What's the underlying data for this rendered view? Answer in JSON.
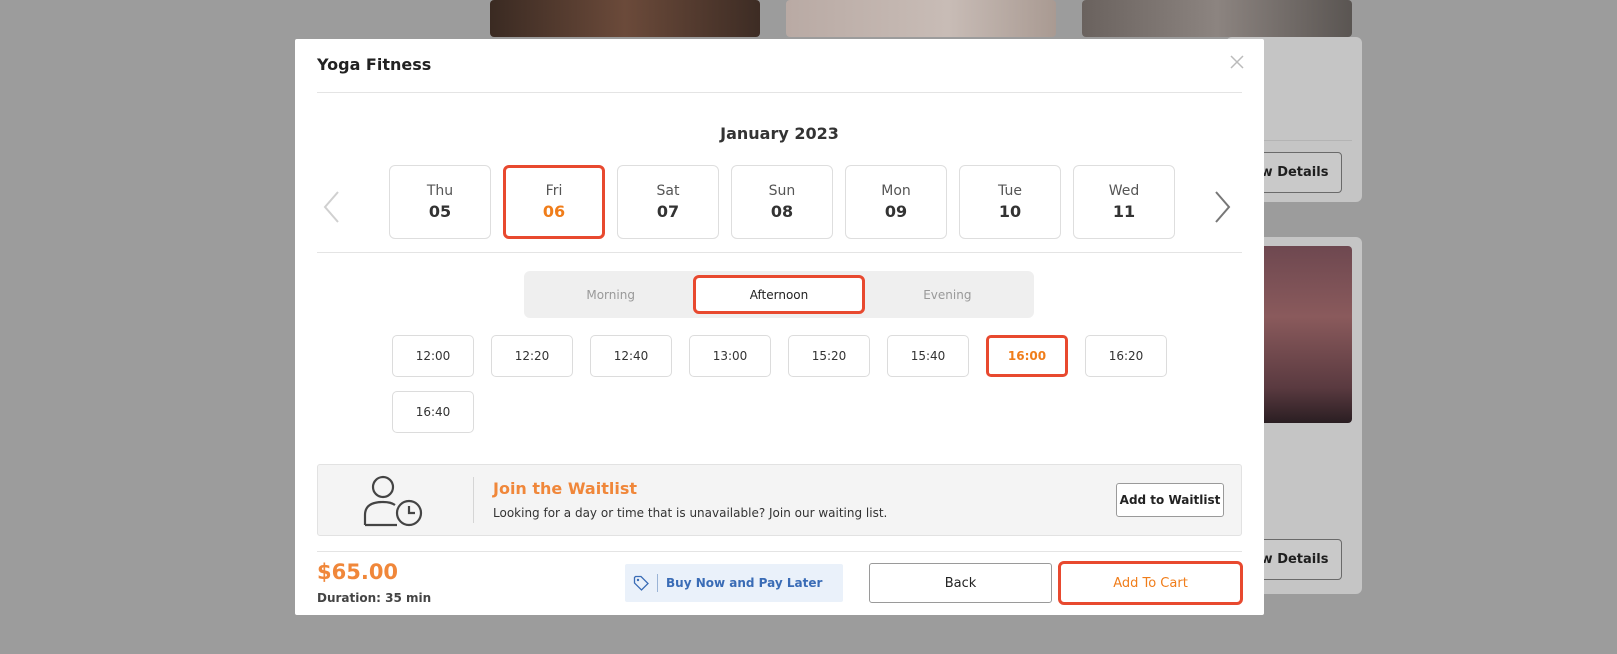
{
  "background": {
    "view_details_label": "View Details"
  },
  "modal": {
    "title": "Yoga Fitness",
    "month": "January 2023",
    "dates": [
      {
        "dow": "Thu",
        "num": "05"
      },
      {
        "dow": "Fri",
        "num": "06"
      },
      {
        "dow": "Sat",
        "num": "07"
      },
      {
        "dow": "Sun",
        "num": "08"
      },
      {
        "dow": "Mon",
        "num": "09"
      },
      {
        "dow": "Tue",
        "num": "10"
      },
      {
        "dow": "Wed",
        "num": "11"
      }
    ],
    "selected_date_index": 1,
    "periods": [
      "Morning",
      "Afternoon",
      "Evening"
    ],
    "selected_period_index": 1,
    "times": [
      "12:00",
      "12:20",
      "12:40",
      "13:00",
      "15:20",
      "15:40",
      "16:00",
      "16:20",
      "16:40"
    ],
    "selected_time_index": 6,
    "waitlist": {
      "title": "Join the Waitlist",
      "description": "Looking for a day or time that is unavailable? Join our waiting list.",
      "button": "Add to Waitlist"
    },
    "price": "$65.00",
    "duration": "Duration: 35 min",
    "bnpl_label": "Buy Now and Pay Later",
    "back_label": "Back",
    "add_to_cart_label": "Add To Cart"
  },
  "colors": {
    "accent": "#f0873a",
    "highlight_border": "#e8492f",
    "link_blue": "#3a6cb6",
    "overlay": "#9c9c9c"
  }
}
